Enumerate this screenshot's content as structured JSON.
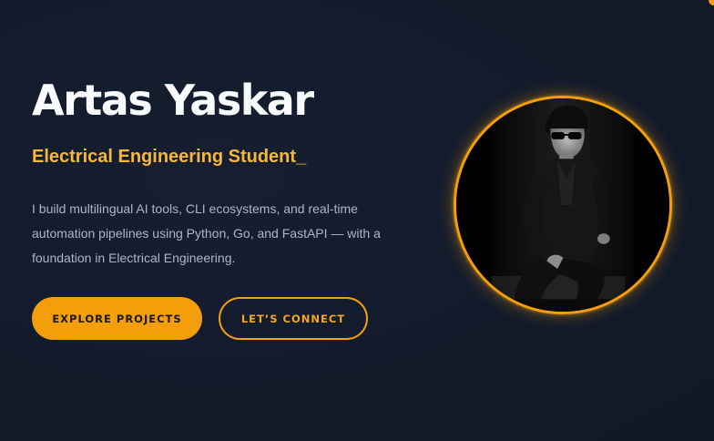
{
  "hero": {
    "name": "Artas Yaskar",
    "subtitle": "Electrical Engineering Student_",
    "bio": "I build multilingual AI tools, CLI ecosystems, and real-time automation pipelines using Python, Go, and FastAPI — with a foundation in Electrical Engineering.",
    "primary_button": "EXPLORE PROJECTS",
    "secondary_button": "LET’S CONNECT"
  },
  "colors": {
    "background": "#121a2a",
    "accent": "#f59e0b",
    "heading": "#f8fafc",
    "body_text": "#aeb6c4"
  },
  "avatar": {
    "icon": "profile-photo",
    "style": "black-and-white portrait"
  }
}
